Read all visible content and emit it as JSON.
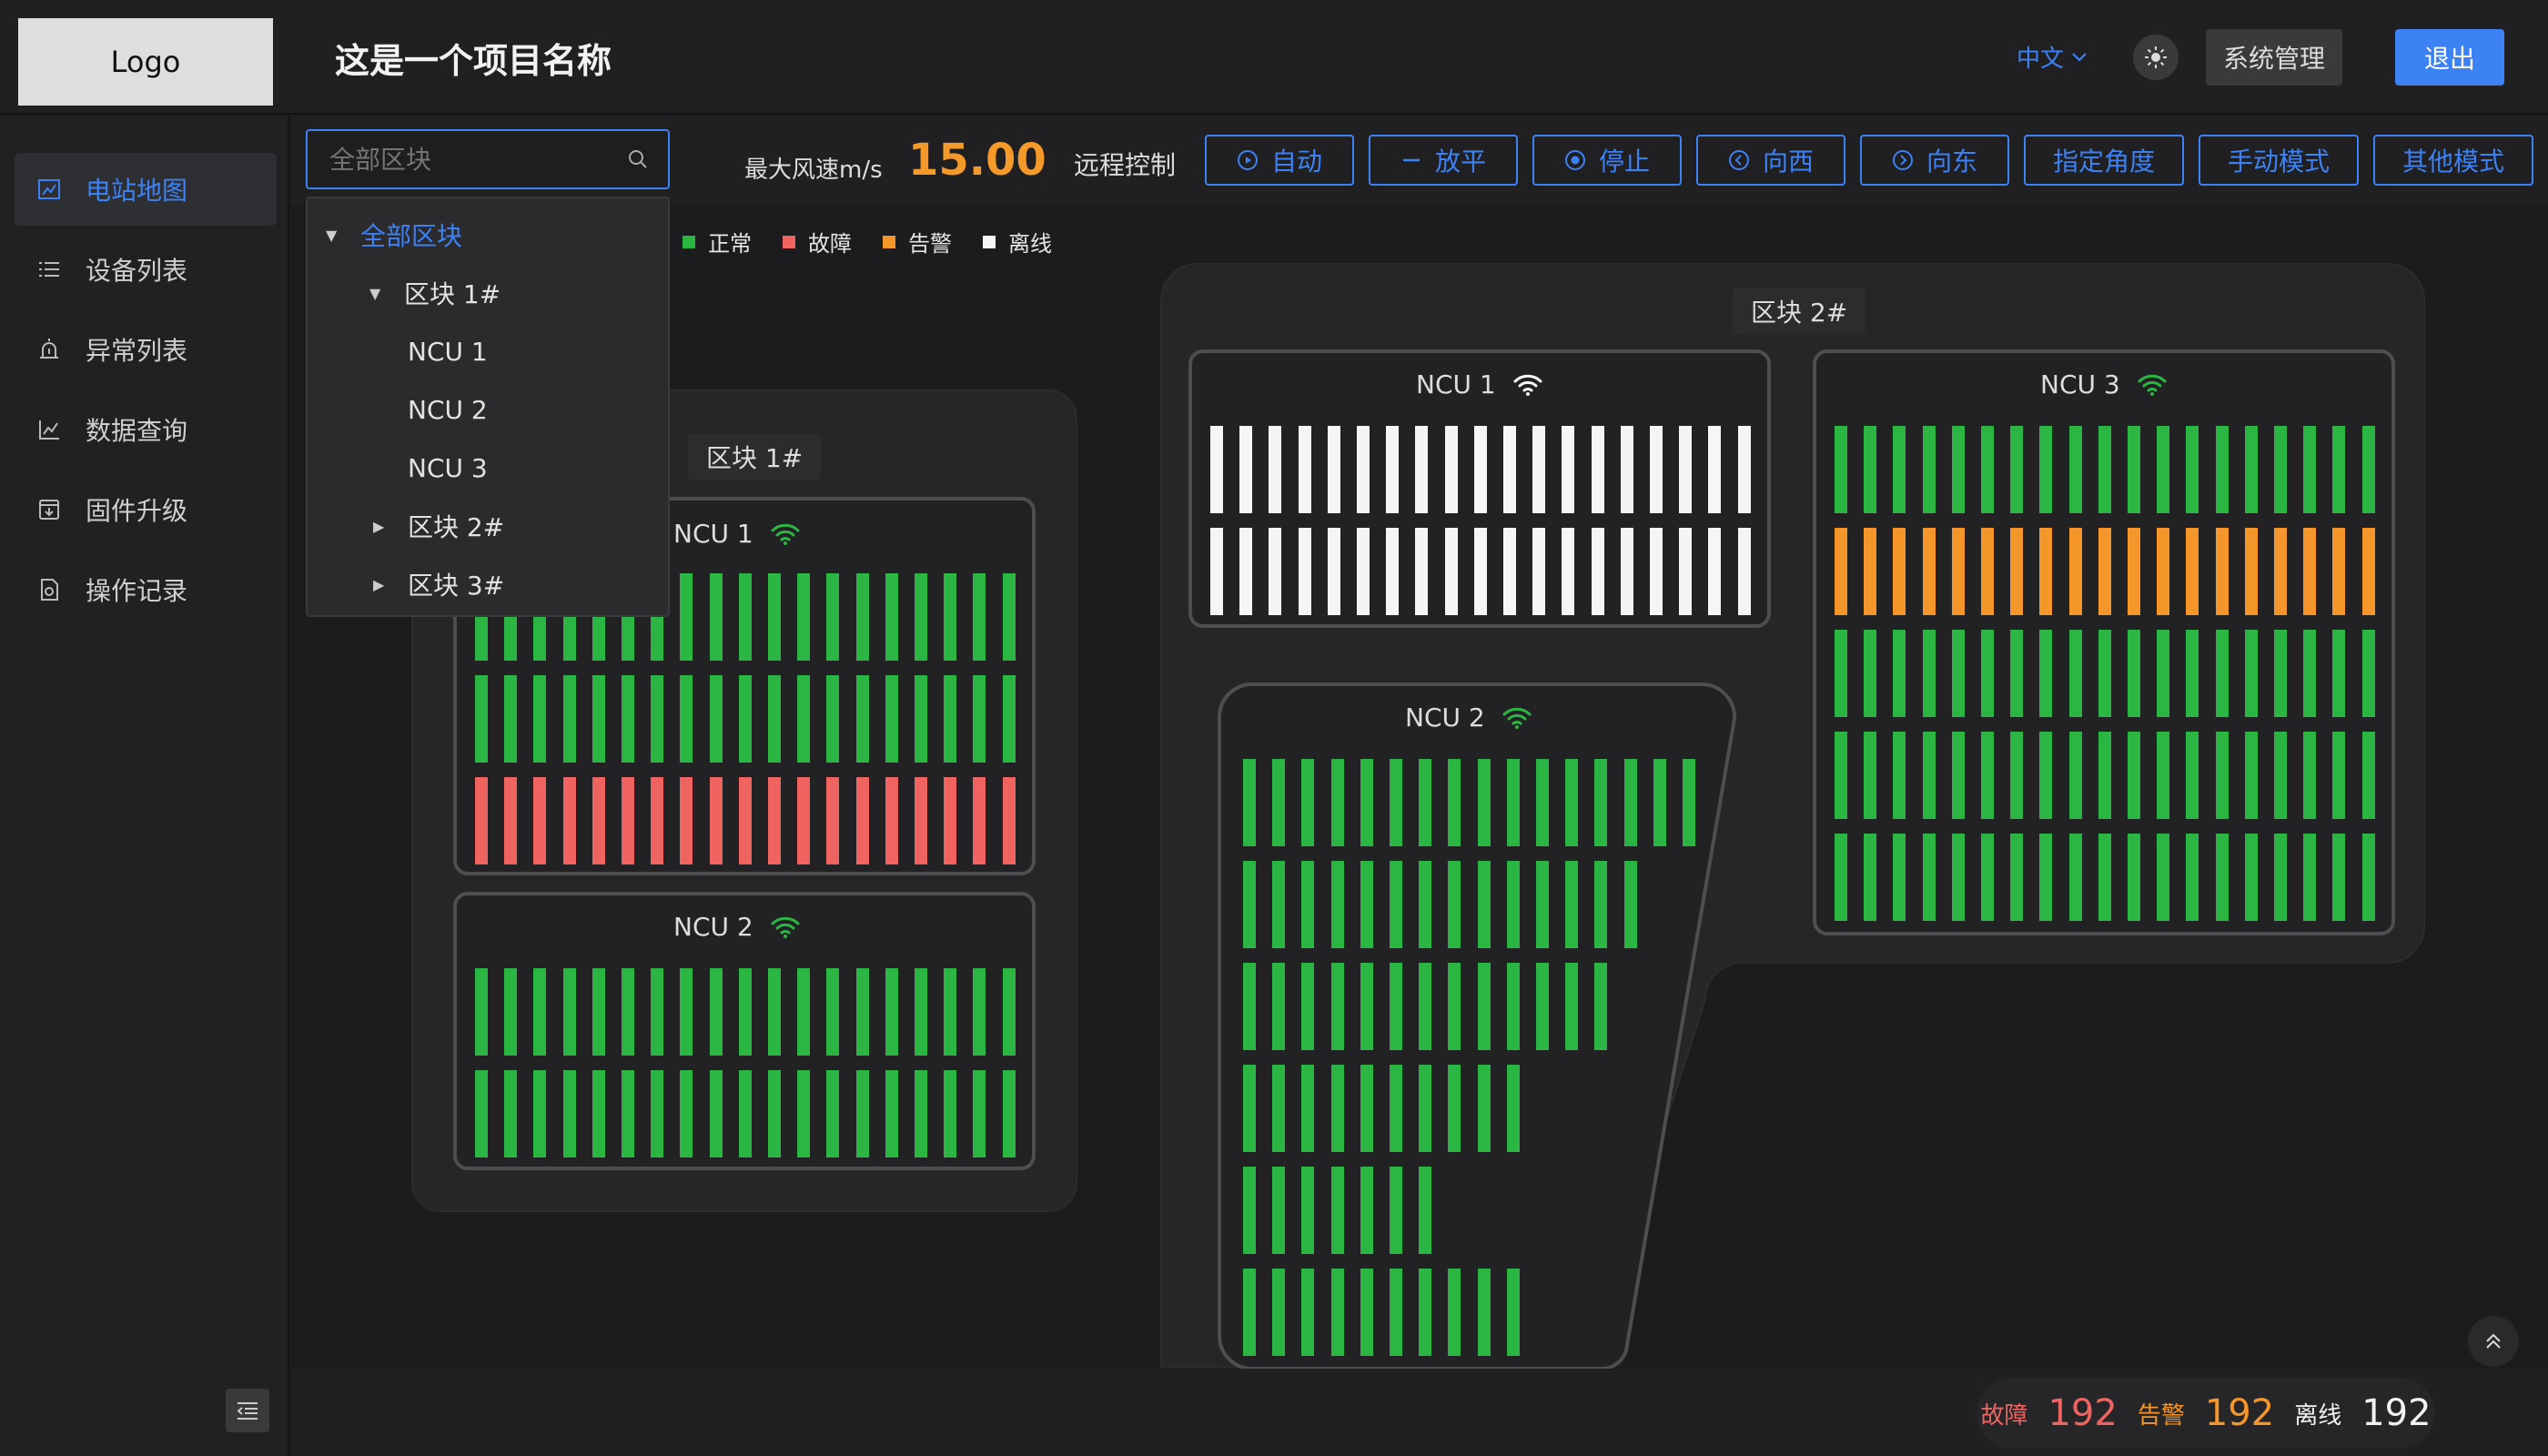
{
  "app": {
    "logo": "Logo",
    "title": "这是一个项目名称",
    "lang": "中文",
    "system_btn": "系统管理",
    "logout_btn": "退出"
  },
  "sidebar": {
    "items": [
      {
        "label": "电站地图",
        "icon": "map-icon"
      },
      {
        "label": "设备列表",
        "icon": "list-icon"
      },
      {
        "label": "异常列表",
        "icon": "alarm-icon"
      },
      {
        "label": "数据查询",
        "icon": "chart-icon"
      },
      {
        "label": "固件升级",
        "icon": "upgrade-icon"
      },
      {
        "label": "操作记录",
        "icon": "record-icon"
      }
    ]
  },
  "toolbar": {
    "search_placeholder": "全部区块",
    "wind_label": "最大风速m/s",
    "wind_value": "15.00",
    "remote_label": "远程控制",
    "buttons": [
      "自动",
      "放平",
      "停止",
      "向西",
      "向东",
      "指定角度",
      "手动模式",
      "其他模式"
    ]
  },
  "tree": [
    {
      "label": "全部区块",
      "level": 0,
      "expanded": true,
      "selected": true
    },
    {
      "label": "区块 1#",
      "level": 1,
      "expanded": true
    },
    {
      "label": "NCU 1",
      "level": 2
    },
    {
      "label": "NCU 2",
      "level": 2
    },
    {
      "label": "NCU 3",
      "level": 2
    },
    {
      "label": "区块 2#",
      "level": 1,
      "expanded": false
    },
    {
      "label": "区块 3#",
      "level": 1,
      "expanded": false
    }
  ],
  "legend": [
    {
      "label": "正常",
      "color": "#2bb644"
    },
    {
      "label": "故障",
      "color": "#ef6460"
    },
    {
      "label": "告警",
      "color": "#f5962a"
    },
    {
      "label": "离线",
      "color": "#f5f5f5"
    }
  ],
  "colors": {
    "normal": "#2bb644",
    "fault": "#ef6460",
    "warning": "#f5962a",
    "offline": "#f5f5f5",
    "accent": "#3d82f5"
  },
  "blocks": [
    {
      "title": "区块 1#",
      "ncus": [
        {
          "title": "NCU 1",
          "wifi": "green",
          "rows": [
            {
              "count": 19,
              "status": "normal"
            },
            {
              "count": 19,
              "status": "normal"
            },
            {
              "count": 19,
              "status": "fault"
            }
          ]
        },
        {
          "title": "NCU 2",
          "wifi": "green",
          "rows": [
            {
              "count": 19,
              "status": "normal"
            },
            {
              "count": 19,
              "status": "normal"
            }
          ]
        }
      ]
    },
    {
      "title": "区块 2#",
      "ncus": [
        {
          "title": "NCU 1",
          "wifi": "white",
          "rows": [
            {
              "count": 19,
              "status": "offline"
            },
            {
              "count": 19,
              "status": "offline"
            }
          ]
        },
        {
          "title": "NCU 2",
          "wifi": "green",
          "rows": [
            {
              "count": 16,
              "status": "normal"
            },
            {
              "count": 14,
              "status": "normal"
            },
            {
              "count": 13,
              "status": "normal"
            },
            {
              "count": 10,
              "status": "normal"
            },
            {
              "count": 7,
              "status": "normal"
            },
            {
              "count": 10,
              "status": "normal"
            }
          ]
        },
        {
          "title": "NCU 3",
          "wifi": "green",
          "rows": [
            {
              "count": 19,
              "status": "normal"
            },
            {
              "count": 19,
              "status": "warning"
            },
            {
              "count": 19,
              "status": "normal"
            },
            {
              "count": 19,
              "status": "normal"
            },
            {
              "count": 19,
              "status": "normal"
            }
          ]
        }
      ]
    }
  ],
  "footer": {
    "fault_label": "故障",
    "fault_value": "192",
    "warning_label": "告警",
    "warning_value": "192",
    "offline_label": "离线",
    "offline_value": "192"
  }
}
